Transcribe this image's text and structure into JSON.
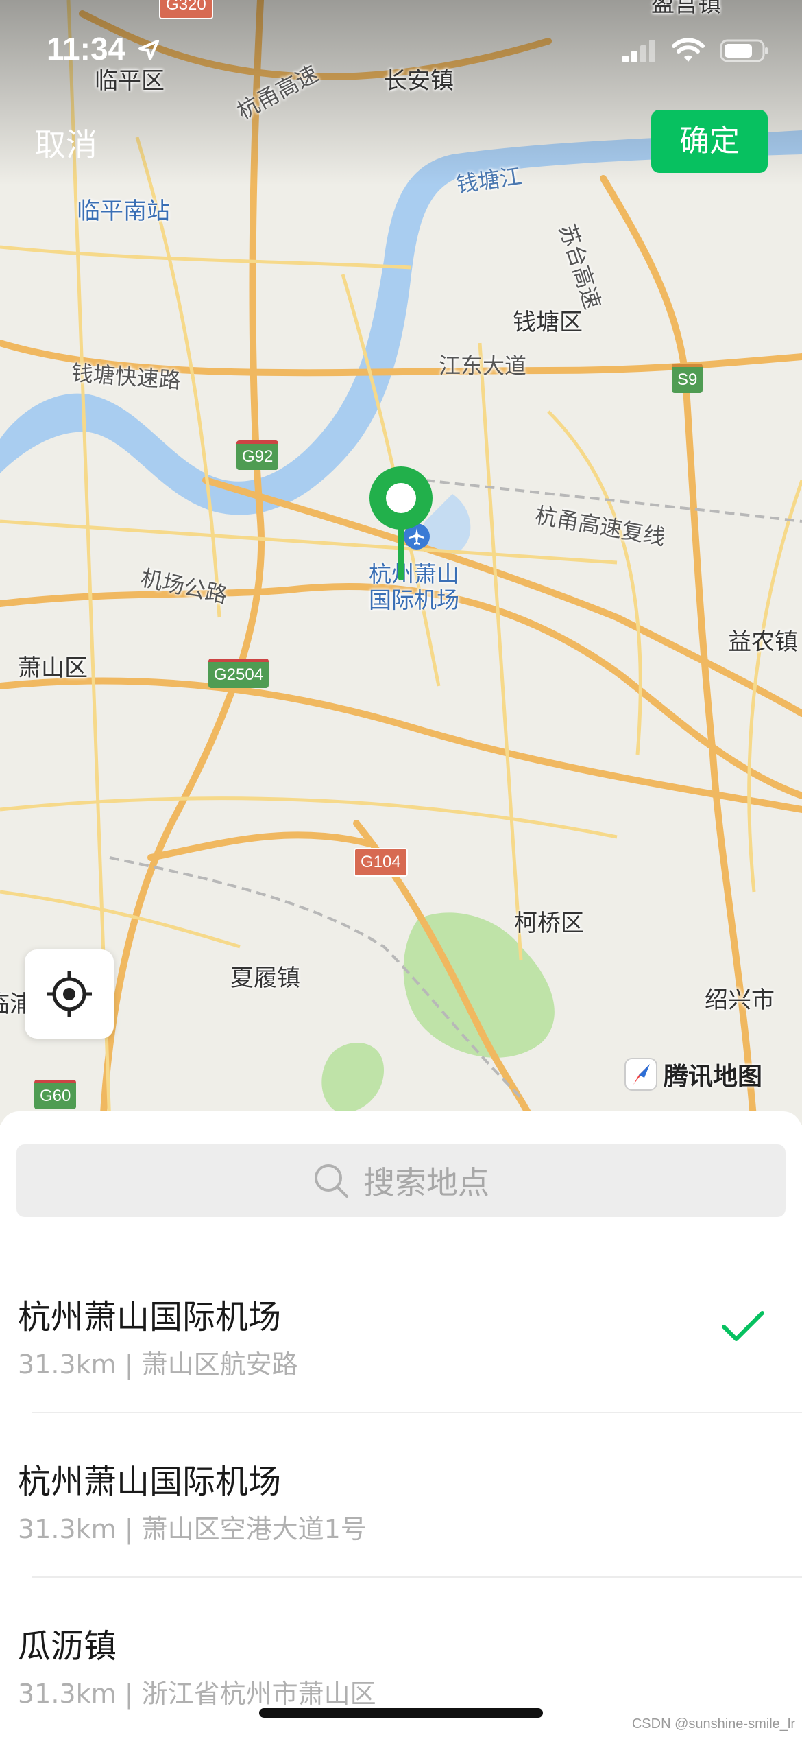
{
  "status_bar": {
    "time": "11:34"
  },
  "header": {
    "cancel_label": "取消",
    "confirm_label": "确定"
  },
  "map": {
    "places": {
      "linping": "临平区",
      "changan": "长安镇",
      "linping_south": "临平南站",
      "qiantang_district": "钱塘区",
      "xiaoshan_district": "萧山区",
      "yinong": "益农镇",
      "keqiao": "柯桥区",
      "xialv": "夏履镇",
      "shaoxing": "绍兴市",
      "linpu": "临浦",
      "yingong": "盈宫镇",
      "airport": "杭州萧山\n国际机场"
    },
    "roads": {
      "hangyong": "杭甬高速",
      "sutai": "苏台高速",
      "qiantang_river": "钱塘江",
      "jiangdong": "江东大道",
      "qiantang_express": "钱塘快速路",
      "hangyong_fuxian": "杭甬高速复线",
      "airport_road": "机场公路"
    },
    "shields": {
      "g320": "G320",
      "g92": "G92",
      "s9": "S9",
      "g2504": "G2504",
      "g104": "G104",
      "g60": "G60"
    },
    "attribution": "腾讯地图"
  },
  "search": {
    "placeholder": "搜索地点"
  },
  "results": [
    {
      "title": "杭州萧山国际机场",
      "subtitle": "31.3km | 萧山区航安路",
      "selected": true
    },
    {
      "title": "杭州萧山国际机场",
      "subtitle": "31.3km | 萧山区空港大道1号",
      "selected": false
    },
    {
      "title": "瓜沥镇",
      "subtitle": "31.3km | 浙江省杭州市萧山区",
      "selected": false
    }
  ],
  "watermark": "CSDN @sunshine-smile_lr",
  "colors": {
    "accent_green": "#07c160",
    "river_blue": "#a9cdf0",
    "road_orange": "#f0b860",
    "park_green": "#bfe3a8"
  }
}
